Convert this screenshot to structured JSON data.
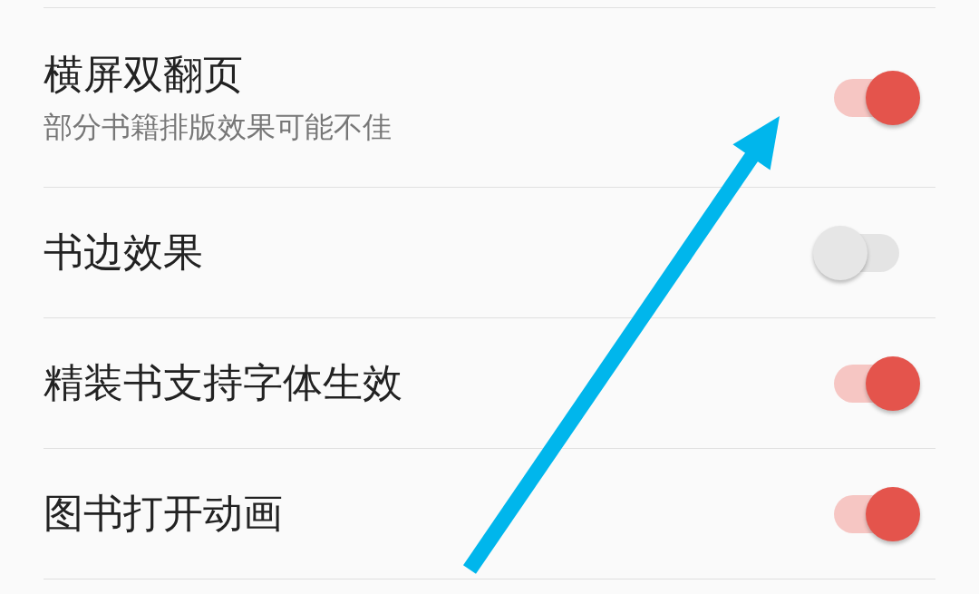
{
  "settings": [
    {
      "title": "横屏双翻页",
      "subtitle": "部分书籍排版效果可能不佳",
      "on": true
    },
    {
      "title": "书边效果",
      "on": false
    },
    {
      "title": "精装书支持字体生效",
      "on": true
    },
    {
      "title": "图书打开动画",
      "on": true
    }
  ]
}
